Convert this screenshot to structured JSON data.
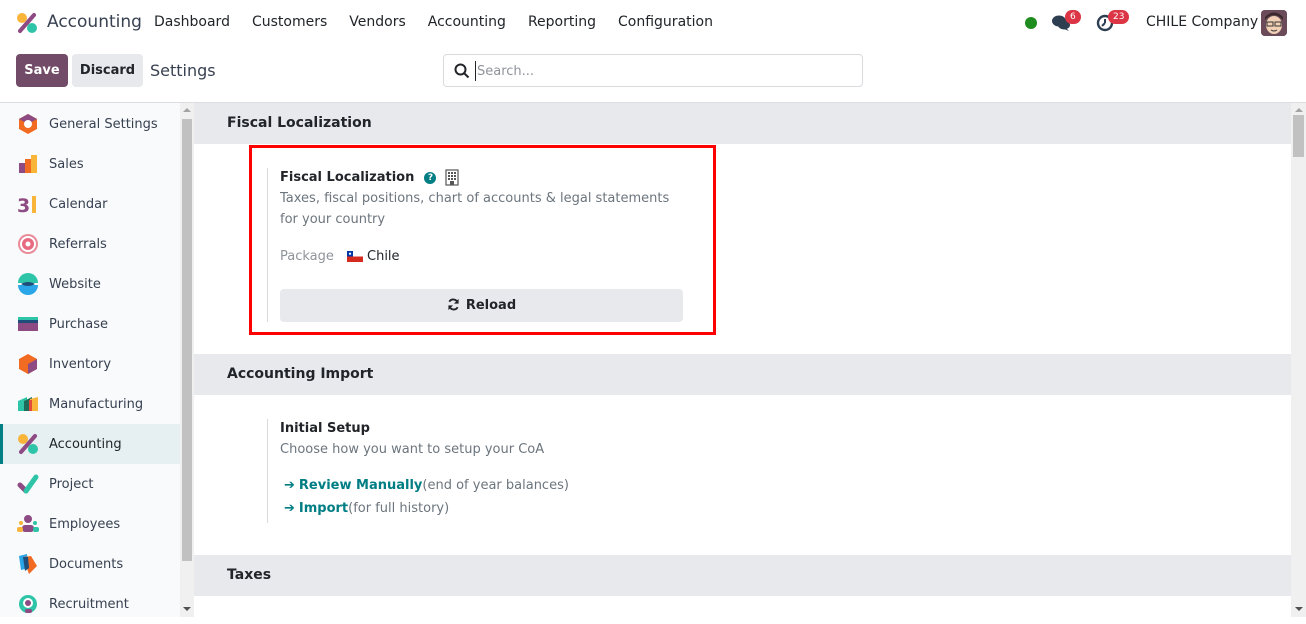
{
  "navbar": {
    "app_name": "Accounting",
    "menu": [
      "Dashboard",
      "Customers",
      "Vendors",
      "Accounting",
      "Reporting",
      "Configuration"
    ],
    "chat_count": "6",
    "activity_count": "23",
    "company": "CHILE Company",
    "presence_color": "#1e8c1e"
  },
  "control": {
    "save_label": "Save",
    "discard_label": "Discard",
    "breadcrumb": "Settings",
    "search_placeholder": "Search...",
    "search_value": ""
  },
  "sidebar": {
    "active": "Accounting",
    "items": [
      {
        "label": "General Settings",
        "icon": "general-settings-icon"
      },
      {
        "label": "Sales",
        "icon": "sales-icon"
      },
      {
        "label": "Calendar",
        "icon": "calendar-icon"
      },
      {
        "label": "Referrals",
        "icon": "referrals-icon"
      },
      {
        "label": "Website",
        "icon": "website-icon"
      },
      {
        "label": "Purchase",
        "icon": "purchase-icon"
      },
      {
        "label": "Inventory",
        "icon": "inventory-icon"
      },
      {
        "label": "Manufacturing",
        "icon": "manufacturing-icon"
      },
      {
        "label": "Accounting",
        "icon": "accounting-icon"
      },
      {
        "label": "Project",
        "icon": "project-icon"
      },
      {
        "label": "Employees",
        "icon": "employees-icon"
      },
      {
        "label": "Documents",
        "icon": "documents-icon"
      },
      {
        "label": "Recruitment",
        "icon": "recruitment-icon"
      }
    ]
  },
  "sections": {
    "fiscal": {
      "title": "Fiscal Localization",
      "setting_title": "Fiscal Localization",
      "help": "?",
      "description": "Taxes, fiscal positions, chart of accounts & legal statements for your country",
      "package_label": "Package",
      "package_value": "Chile",
      "reload_label": "Reload"
    },
    "import": {
      "title": "Accounting Import",
      "setting_title": "Initial Setup",
      "description": "Choose how you want to setup your CoA",
      "links": [
        {
          "label": "Review Manually",
          "note": "(end of year balances)"
        },
        {
          "label": "Import",
          "note": "(for full history)"
        }
      ]
    },
    "taxes": {
      "title": "Taxes"
    }
  },
  "colors": {
    "brand": "#714b67",
    "accent": "#017e84",
    "badge": "#dc3545",
    "highlight": "#ff0000"
  }
}
